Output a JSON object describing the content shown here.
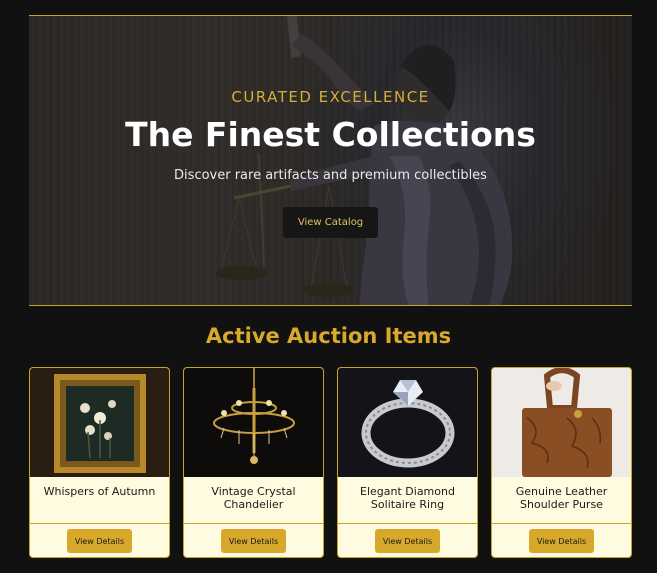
{
  "hero": {
    "eyebrow": "CURATED EXCELLENCE",
    "title": "The Finest Collections",
    "subtitle": "Discover rare artifacts and premium collectibles",
    "cta_label": "View Catalog"
  },
  "auctions": {
    "title": "Active Auction Items",
    "items": [
      {
        "name": "Whispers of Autumn",
        "button": "View Details",
        "image": "framed-flower-painting"
      },
      {
        "name": "Vintage Crystal Chandelier",
        "button": "View Details",
        "image": "crystal-chandelier"
      },
      {
        "name": "Elegant Diamond Solitaire Ring",
        "button": "View Details",
        "image": "diamond-ring"
      },
      {
        "name": "Genuine Leather Shoulder Purse",
        "button": "View Details",
        "image": "leather-purse"
      }
    ]
  },
  "colors": {
    "background": "#121111",
    "accent": "#d4af37",
    "button_gold": "#d8a82a",
    "card_bg": "#fffbe0"
  }
}
